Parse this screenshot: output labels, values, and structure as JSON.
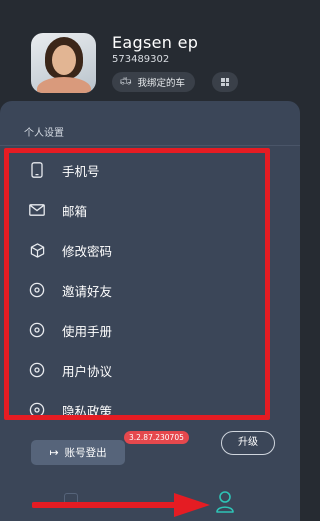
{
  "profile": {
    "name": "Eagsen ep",
    "id": "573489302",
    "car_button_label": "我绑定的车"
  },
  "settings": {
    "section_title": "个人设置",
    "items": [
      {
        "label": "手机号",
        "icon": "phone-icon"
      },
      {
        "label": "邮箱",
        "icon": "mail-icon"
      },
      {
        "label": "修改密码",
        "icon": "cube-icon"
      },
      {
        "label": "邀请好友",
        "icon": "eye-icon"
      },
      {
        "label": "使用手册",
        "icon": "eye-icon"
      },
      {
        "label": "用户协议",
        "icon": "eye-icon"
      },
      {
        "label": "隐私政策",
        "icon": "eye-icon"
      }
    ]
  },
  "version": {
    "badge": "3.2.87.230705",
    "upgrade_label": "升级"
  },
  "logout_label": "账号登出",
  "colors": {
    "background": "#262b32",
    "panel": "#3b4658",
    "highlight_annotation": "#e51c23",
    "badge": "#e5484d",
    "active_tab": "#2ec4b6"
  }
}
